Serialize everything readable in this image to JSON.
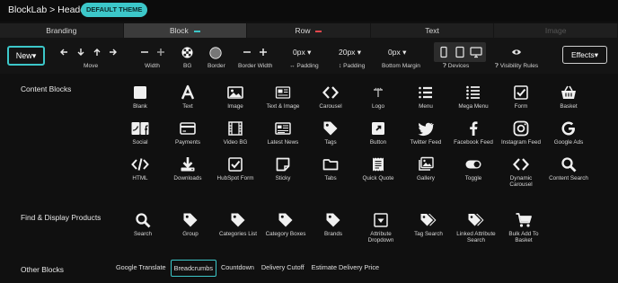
{
  "header": {
    "title": "BlockLab > Header",
    "badge": "DEFAULT THEME"
  },
  "tabs": [
    {
      "label": "Branding",
      "state": "normal"
    },
    {
      "label": "Block",
      "state": "active",
      "mark_color": "#3cc7c9"
    },
    {
      "label": "Row",
      "state": "normal",
      "mark_color": "#e5484d"
    },
    {
      "label": "Text",
      "state": "normal"
    },
    {
      "label": "Image",
      "state": "disabled"
    }
  ],
  "toolbar": {
    "new_label": "New",
    "move_label": "Move",
    "width_label": "Width",
    "bg_label": "BG",
    "border_label": "Border",
    "border_width_label": "Border Width",
    "padding_value": "0px",
    "padding_label": "↔ Padding",
    "vpadding_value": "20px",
    "vpadding_label": "↕ Padding",
    "bottom_margin_value": "0px",
    "bottom_margin_label": "Bottom Margin",
    "devices_label": "Devices",
    "visibility_label": "Visibility Rules",
    "effects_label": "Effects"
  },
  "sections": {
    "content_blocks": "Content Blocks",
    "find_display": "Find & Display Products",
    "other_blocks": "Other Blocks"
  },
  "content_blocks": [
    {
      "label": "Blank",
      "icon": "square-icon"
    },
    {
      "label": "Text",
      "icon": "text-a-icon"
    },
    {
      "label": "Image",
      "icon": "image-icon"
    },
    {
      "label": "Text & Image",
      "icon": "text-image-icon"
    },
    {
      "label": "Carousel",
      "icon": "chevrons-icon"
    },
    {
      "label": "Logo",
      "icon": "logo-icon"
    },
    {
      "label": "Menu",
      "icon": "list-icon"
    },
    {
      "label": "Mega Menu",
      "icon": "mega-list-icon"
    },
    {
      "label": "Form",
      "icon": "checkbox-icon"
    },
    {
      "label": "Basket",
      "icon": "basket-icon"
    },
    {
      "label": "Social",
      "icon": "social-icon"
    },
    {
      "label": "Payments",
      "icon": "card-icon"
    },
    {
      "label": "Video BG",
      "icon": "film-icon"
    },
    {
      "label": "Latest News",
      "icon": "newspaper-icon"
    },
    {
      "label": "Tags",
      "icon": "tag-icon"
    },
    {
      "label": "Button",
      "icon": "button-icon"
    },
    {
      "label": "Twitter Feed",
      "icon": "twitter-icon"
    },
    {
      "label": "Facebook Feed",
      "icon": "facebook-icon"
    },
    {
      "label": "Instagram Feed",
      "icon": "instagram-icon"
    },
    {
      "label": "Google Ads",
      "icon": "google-icon"
    },
    {
      "label": "HTML",
      "icon": "code-icon"
    },
    {
      "label": "Downloads",
      "icon": "download-icon"
    },
    {
      "label": "HubSpot Form",
      "icon": "checkbox-icon"
    },
    {
      "label": "Sticky",
      "icon": "sticky-icon"
    },
    {
      "label": "Tabs",
      "icon": "folder-icon"
    },
    {
      "label": "Quick Quote",
      "icon": "receipt-icon"
    },
    {
      "label": "Gallery",
      "icon": "gallery-icon"
    },
    {
      "label": "Toggle",
      "icon": "toggle-icon"
    },
    {
      "label": "Dynamic Carousel",
      "icon": "chevrons-icon"
    },
    {
      "label": "Content Search",
      "icon": "search-icon"
    }
  ],
  "products": [
    {
      "label": "Search",
      "icon": "search-icon"
    },
    {
      "label": "Group",
      "icon": "tag-icon"
    },
    {
      "label": "Categories List",
      "icon": "tag-icon"
    },
    {
      "label": "Category Boxes",
      "icon": "tag-icon"
    },
    {
      "label": "Brands",
      "icon": "tag-icon"
    },
    {
      "label": "Attribute Dropdown",
      "icon": "dropdown-icon"
    },
    {
      "label": "Tag Search",
      "icon": "tags-icon"
    },
    {
      "label": "Linked Attribute Search",
      "icon": "tags-icon"
    },
    {
      "label": "Bulk Add To Basket",
      "icon": "cart-icon"
    }
  ],
  "other_blocks": [
    {
      "label": "Google Translate",
      "active": false
    },
    {
      "label": "Breadcrumbs",
      "active": true
    },
    {
      "label": "Countdown",
      "active": false
    },
    {
      "label": "Delivery Cutoff",
      "active": false
    },
    {
      "label": "Estimate Delivery Price",
      "active": false
    }
  ],
  "colors": {
    "accent": "#3cc7c9",
    "row_mark": "#e5484d",
    "icon": "#f0f0f0"
  }
}
